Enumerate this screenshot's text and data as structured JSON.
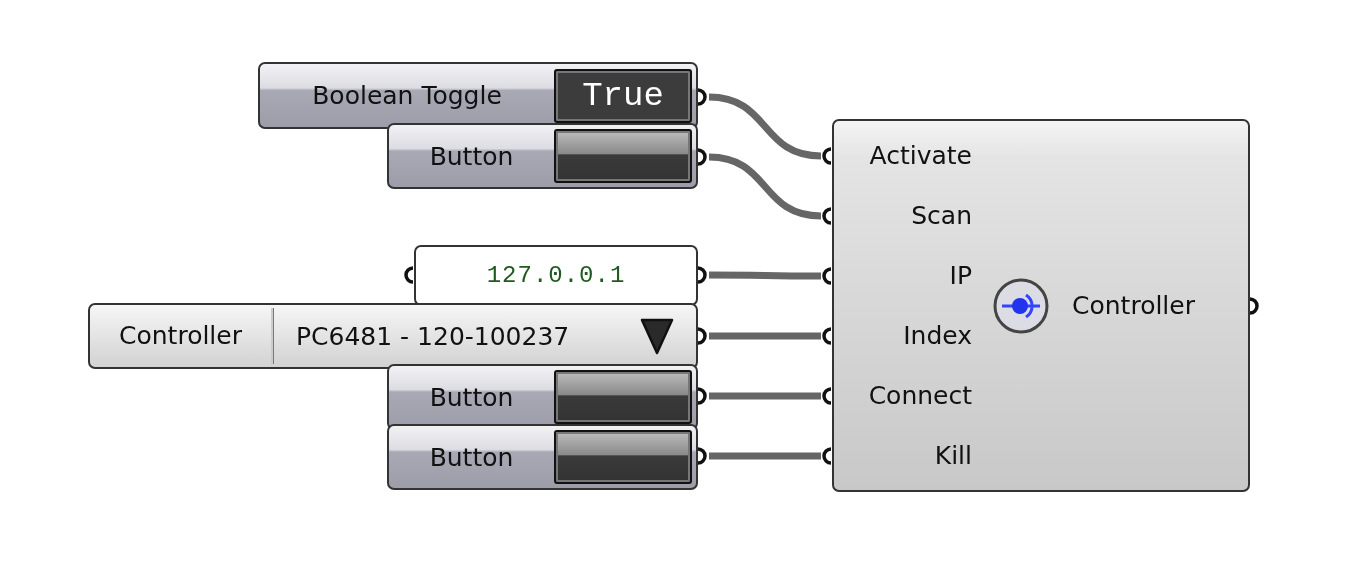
{
  "toggle": {
    "label": "Boolean Toggle",
    "value": "True"
  },
  "buttons": [
    {
      "label": "Button"
    },
    {
      "label": "Button"
    },
    {
      "label": "Button"
    }
  ],
  "panel": {
    "value": "127.0.0.1"
  },
  "value_list": {
    "label": "Controller",
    "value": "PC6481 - 120-100237"
  },
  "component": {
    "inputs": [
      "Activate",
      "Scan",
      "IP",
      "Index",
      "Connect",
      "Kill"
    ],
    "output": "Controller"
  }
}
